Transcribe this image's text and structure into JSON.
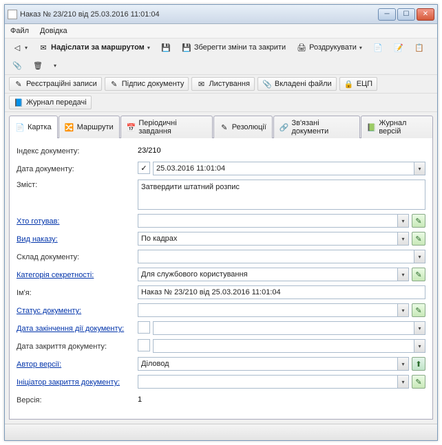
{
  "window": {
    "title": "Наказ № 23/210 від 25.03.2016 11:01:04"
  },
  "menubar": {
    "file": "Файл",
    "help": "Довідка"
  },
  "toolbar1": {
    "send_route": "Надіслати за маршрутом",
    "save_close": "Зберегти зміни та закрити",
    "print": "Роздрукувати"
  },
  "toolbar2": {
    "reg": "Реєстраційні записи",
    "sign": "Підпис документу",
    "mail": "Листування",
    "attach": "Вкладені файли",
    "ecp": "ЕЦП",
    "transfer": "Журнал передачі"
  },
  "tabs": {
    "card": "Картка",
    "routes": "Маршрути",
    "periodic": "Періодичні завдання",
    "resolutions": "Резолюції",
    "linked": "Зв'язані документи",
    "versions": "Журнал версій"
  },
  "labels": {
    "index": "Індекс документу:",
    "date": "Дата документу:",
    "content": "Зміст:",
    "prepared": "Хто готував:",
    "order_type": "Вид наказу:",
    "composition": "Склад документу:",
    "secrecy": "Категорія секретності:",
    "name": "Ім'я:",
    "status": "Статус документу:",
    "end_date": "Дата закінчення дії документу:",
    "close_date": "Дата закриття документу:",
    "author": "Автор версії:",
    "closer": "Ініціатор закриття документу:",
    "version": "Версія:"
  },
  "values": {
    "index": "23/210",
    "date": "25.03.2016 11:01:04",
    "content": "Затвердити штатний розпис",
    "prepared": "",
    "order_type": "По кадрах",
    "composition": "",
    "secrecy": "Для службового користування",
    "name": "Наказ № 23/210 від 25.03.2016 11:01:04",
    "status": "",
    "end_date": "",
    "close_date": "",
    "author": "Діловод",
    "closer": "",
    "version": "1"
  }
}
